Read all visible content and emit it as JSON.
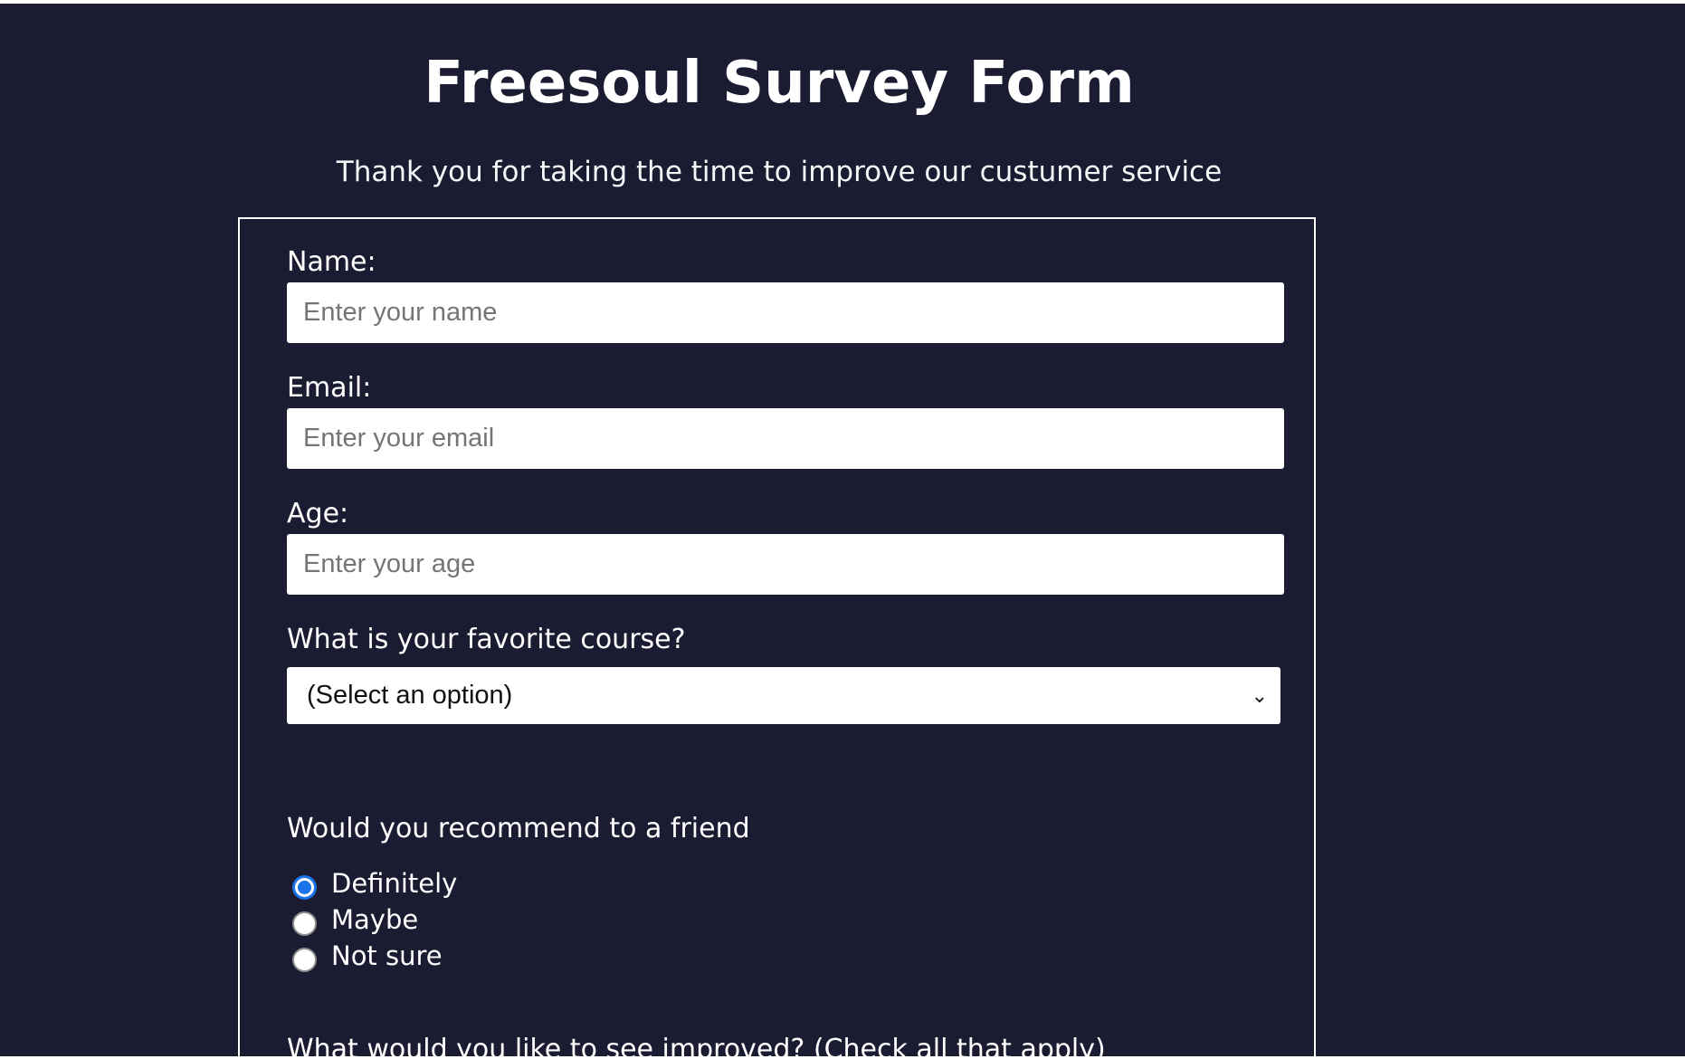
{
  "header": {
    "title": "Freesoul Survey Form",
    "description": "Thank you for taking the time to improve our custumer service"
  },
  "form": {
    "name": {
      "label": "Name:",
      "placeholder": "Enter your name"
    },
    "email": {
      "label": "Email:",
      "placeholder": "Enter your email"
    },
    "age": {
      "label": "Age:",
      "placeholder": "Enter your age"
    },
    "course": {
      "label": "What is your favorite course?",
      "selected": "(Select an option)"
    },
    "recommend": {
      "label": "Would you recommend to a friend",
      "options": [
        {
          "label": "Definitely",
          "checked": true
        },
        {
          "label": "Maybe",
          "checked": false
        },
        {
          "label": "Not sure",
          "checked": false
        }
      ]
    },
    "improvements": {
      "label": "What would you like to see improved? (Check all that apply)"
    }
  },
  "colors": {
    "background": "#1b1b32",
    "text": "#ffffff",
    "radio_accent": "#1a73e8"
  }
}
